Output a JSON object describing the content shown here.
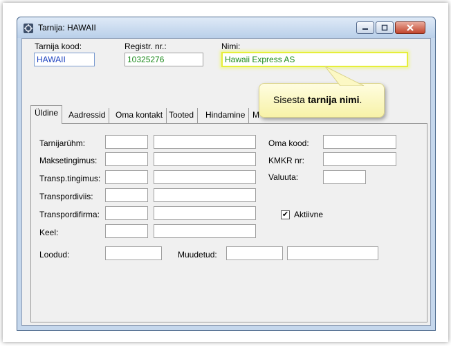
{
  "window": {
    "title": "Tarnija: HAWAII"
  },
  "header": {
    "code_label": "Tarnija kood:",
    "code_value": "HAWAII",
    "reg_label": "Registr. nr.:",
    "reg_value": "10325276",
    "name_label": "Nimi:",
    "name_value": "Hawaii Express AS"
  },
  "tabs": [
    {
      "label": "Üldine"
    },
    {
      "label": "Aadressid"
    },
    {
      "label": "Oma kontakt"
    },
    {
      "label": "Tooted"
    },
    {
      "label": "Hindamine"
    },
    {
      "label": "M"
    }
  ],
  "form": {
    "left_labels": [
      "Tarnijarühm:",
      "Maksetingimus:",
      "Transp.tingimus:",
      "Transpordiviis:",
      "Transpordifirma:",
      "Keel:"
    ],
    "right_labels": [
      "Oma kood:",
      "KMKR nr:",
      "Valuuta:"
    ],
    "active_label": "Aktiivne",
    "active_checked": "✔",
    "created_label": "Loodud:",
    "modified_label": "Muudetud:"
  },
  "tooltip": {
    "prefix": "Sisesta ",
    "bold": "tarnija nimi",
    "suffix": "."
  },
  "colors": {
    "highlight": "#e6ee3a",
    "tooltip_bg": "#f7f2a8",
    "title_bar": "#b9cfe9"
  }
}
